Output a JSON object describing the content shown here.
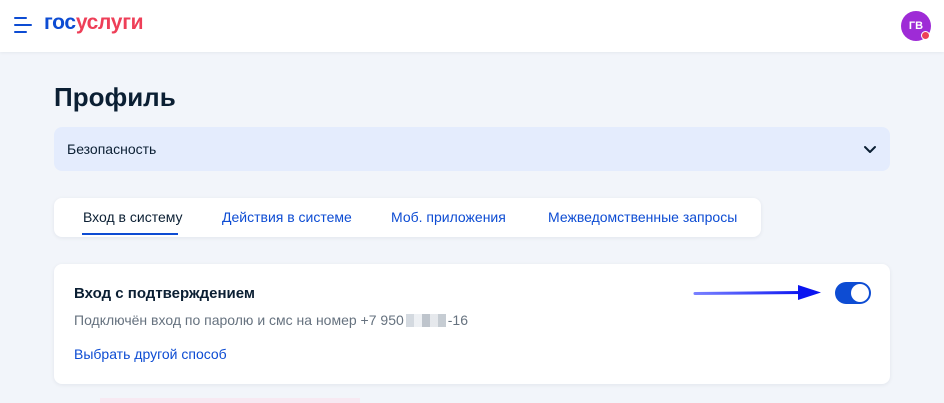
{
  "header": {
    "logo_part1": "гос",
    "logo_part2": "услуги",
    "avatar_initials": "ГВ",
    "colors": {
      "brand_blue": "#0d4cd3",
      "brand_red": "#ee3f58",
      "avatar_bg": "#9e2bd6"
    }
  },
  "page": {
    "title": "Профиль"
  },
  "section_select": {
    "selected": "Безопасность"
  },
  "tabs": [
    {
      "label": "Вход в систему",
      "active": true
    },
    {
      "label": "Действия в системе",
      "active": false
    },
    {
      "label": "Моб. приложения",
      "active": false
    },
    {
      "label": "Межведомственные запросы",
      "active": false
    }
  ],
  "login_card": {
    "title": "Вход с подтверждением",
    "desc_prefix": "Подключён вход по паролю и смс на номер +7 950",
    "desc_suffix": "-16",
    "link": "Выбрать другой способ",
    "toggle_on": true
  }
}
